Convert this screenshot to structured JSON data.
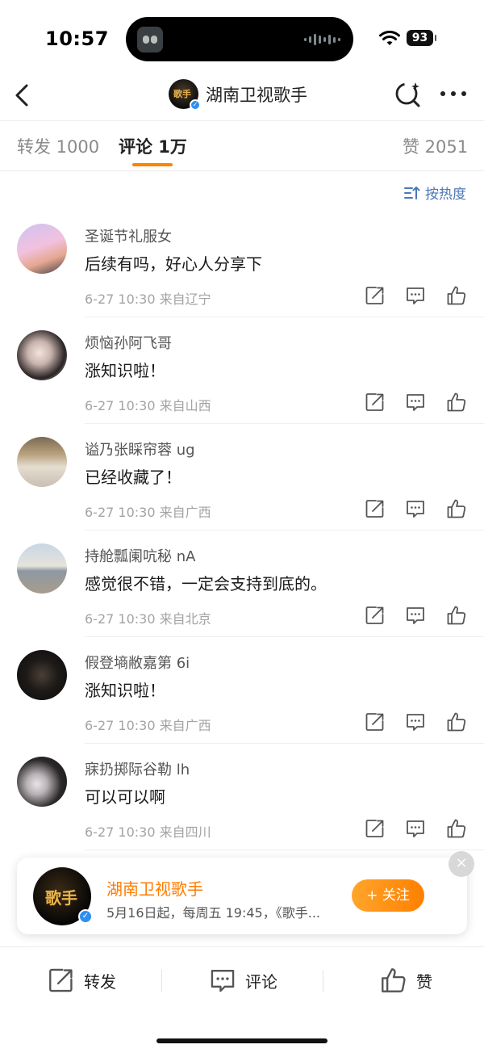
{
  "status_bar": {
    "time": "10:57",
    "battery": "93"
  },
  "nav": {
    "title": "湖南卫视歌手"
  },
  "tabs": [
    {
      "label": "转发 1000"
    },
    {
      "label": "评论 1万"
    },
    {
      "label": "赞 2051"
    }
  ],
  "sort": {
    "label": "按热度"
  },
  "comments": [
    {
      "username": "圣诞节礼服女",
      "content": "后续有吗，好心人分享下",
      "time": "6-27 10:30",
      "location": "来自辽宁"
    },
    {
      "username": "烦恼孙阿飞哥",
      "content": "涨知识啦！",
      "time": "6-27 10:30",
      "location": "来自山西"
    },
    {
      "username": "谥乃张睬帘蓉 ug",
      "content": "已经收藏了！",
      "time": "6-27 10:30",
      "location": "来自广西"
    },
    {
      "username": "持舱瓢阑吭秘 nA",
      "content": "感觉很不错，一定会支持到底的。",
      "time": "6-27 10:30",
      "location": "来自北京"
    },
    {
      "username": "假登墒敝嘉第 6i",
      "content": "涨知识啦！",
      "time": "6-27 10:30",
      "location": "来自广西"
    },
    {
      "username": "寐扔掷际谷勒 lh",
      "content": "可以可以啊",
      "time": "6-27 10:30",
      "location": "来自四川"
    }
  ],
  "popup": {
    "name": "湖南卫视歌手",
    "desc": "5月16日起，每周五 19:45，《歌手...",
    "follow_label": "+ 关注",
    "close": "×"
  },
  "bottom_bar": {
    "repost": "转发",
    "comment": "评论",
    "like": "赞"
  },
  "colors": {
    "accent": "#ff8200",
    "link": "#4d78b7",
    "verify": "#2e8ff0"
  }
}
